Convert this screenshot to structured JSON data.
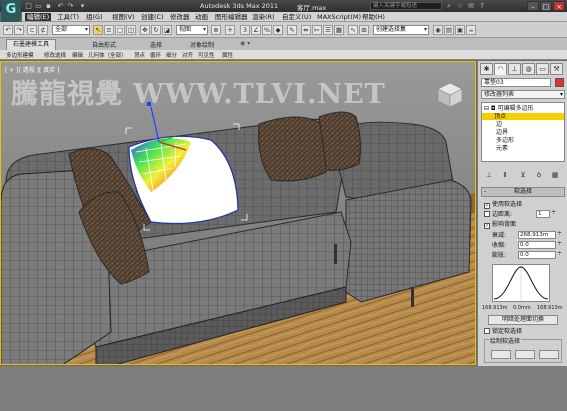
{
  "titlebar": {
    "app_title": "Autodesk 3ds Max  2011",
    "file_name": "客厅.max",
    "search_placeholder": "键入关键字或短语",
    "logo": "G"
  },
  "menubar": {
    "items": [
      "编辑(E)",
      "工具(T)",
      "组(G)",
      "视图(V)",
      "创建(C)",
      "修改器",
      "动画",
      "图形编辑器",
      "渲染(R)",
      "自定义(U)",
      "MAXScript(M)",
      "帮助(H)"
    ]
  },
  "toolbar": {
    "filter_value": "全部",
    "refcoord_value": "视图",
    "selset_value": "创建选择集"
  },
  "ribbon": {
    "tabs": [
      "石墨建模工具",
      "自由形式",
      "选择",
      "对象绘制"
    ],
    "row_items": [
      "多边形建模",
      "修改选择",
      "编辑",
      "几何体（全部）",
      "顶点",
      "循环",
      "细分",
      "对齐",
      "可见性",
      "属性"
    ]
  },
  "viewport": {
    "label": "[ + ][ 透视 ][ 真实 ]",
    "watermark": "騰龍視覺 WWW.TLVI.NET"
  },
  "command_panel": {
    "object_name": "靠垫03",
    "modifier_list": "修改器列表",
    "stack": {
      "root": "可编辑多边形",
      "subobjects": [
        "顶点",
        "边",
        "边界",
        "多边形",
        "元素"
      ],
      "selected_index": 0
    },
    "soft_selection": {
      "title": "软选择",
      "use_soft_selection": "使用软选择",
      "edge_distance": "边距离:",
      "edge_distance_value": "1",
      "affect_backfacing": "影响背面",
      "falloff_label": "衰减:",
      "falloff_value": "268.913m",
      "pinch_label": "收缩:",
      "pinch_value": "0.0",
      "bubble_label": "膨胀:",
      "bubble_value": "0.0",
      "curve_left": "168.913m",
      "curve_mid": "0.0mm",
      "curve_right": "168.913m",
      "shaded_face_toggle": "明暗处理面切换",
      "lock_soft_selection": "锁定软选择",
      "paint_soft_selection": "绘制软选择"
    }
  },
  "colors": {
    "selection_yellow": "#f5d000",
    "object_color": "#e03030",
    "viewport_border": "#f0c000"
  }
}
